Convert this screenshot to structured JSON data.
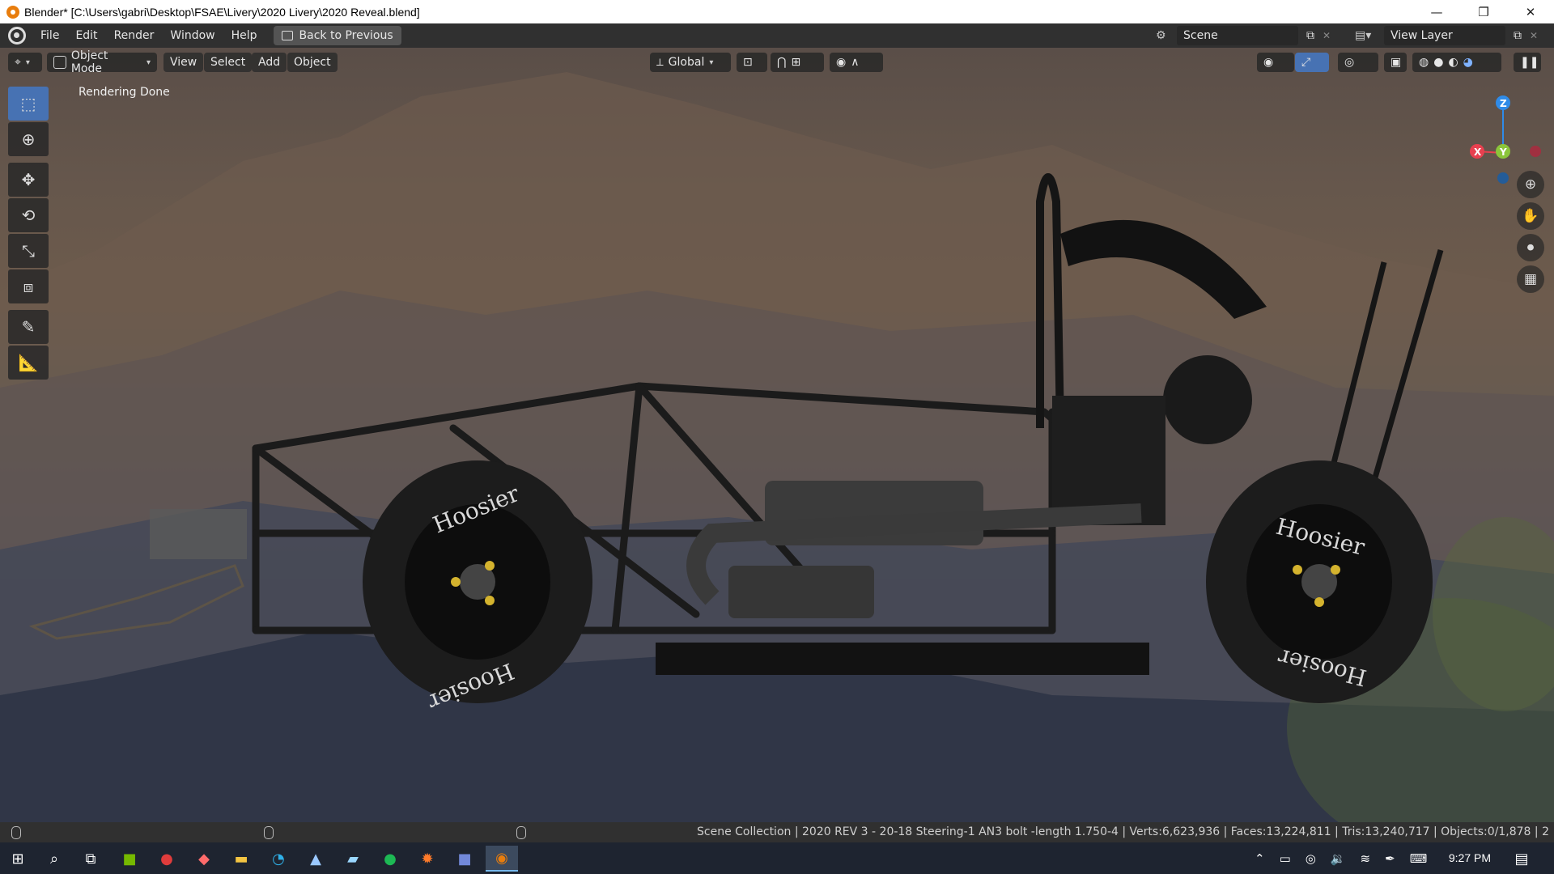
{
  "window": {
    "title": "Blender* [C:\\Users\\gabri\\Desktop\\FSAE\\Livery\\2020 Livery\\2020 Reveal.blend]",
    "controls": [
      "—",
      "❐",
      "✕"
    ]
  },
  "topbar": {
    "menus": [
      "File",
      "Edit",
      "Render",
      "Window",
      "Help"
    ],
    "back_button": "Back to Previous",
    "scene": "Scene",
    "view_layer": "View Layer"
  },
  "viewport_header": {
    "mode": "Object Mode",
    "menus": [
      "View",
      "Select",
      "Add",
      "Object"
    ],
    "transform_orientation": "Global"
  },
  "viewport": {
    "status_text": "Rendering Done",
    "tire_brand": "Hoosier",
    "gizmo_axes": {
      "z": "Z",
      "x": "X",
      "y": "Y"
    },
    "colors": {
      "x_axis": "#e8404f",
      "y_axis": "#8bc53a",
      "z_axis": "#2f8be8"
    }
  },
  "toolbar": {
    "tools": [
      "select-box",
      "cursor",
      "move",
      "rotate",
      "scale",
      "transform",
      "annotate",
      "measure"
    ]
  },
  "statusbar": {
    "stats": "Scene Collection | 2020 REV 3 - 20-18 Steering-1 AN3 bolt -length 1.750-4 | Verts:6,623,936 | Faces:13,224,811 | Tris:13,240,717 | Objects:0/1,878 | 2"
  },
  "taskbar": {
    "clock": "9:27 PM",
    "apps": [
      "start",
      "search",
      "task-view",
      "nvidia",
      "app-red",
      "app-browser",
      "file-explorer",
      "edge",
      "photos",
      "notepad",
      "spotify",
      "bandicam",
      "discord",
      "blender"
    ]
  }
}
